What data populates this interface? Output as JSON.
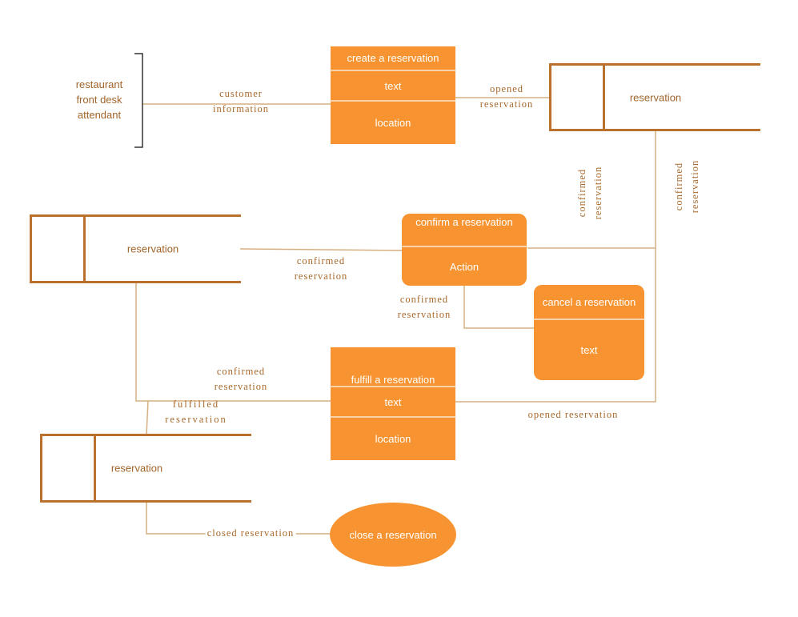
{
  "colors": {
    "process_fill": "#F79431",
    "store_stroke": "#BA712E",
    "flow_line": "#D6AF80",
    "label_text": "#A8692C"
  },
  "external_entity": {
    "lines": [
      "restaurant",
      "front desk",
      "attendant"
    ]
  },
  "processes": {
    "create": {
      "title": "create a reservation",
      "rows": [
        "text",
        "location"
      ]
    },
    "confirm": {
      "title": "confirm a reservation",
      "rows": [
        "Action"
      ]
    },
    "cancel": {
      "title": "cancel a reservation",
      "rows": [
        "text"
      ]
    },
    "fulfill": {
      "title": "fulfill a reservation",
      "rows": [
        "text",
        "location"
      ]
    },
    "close": {
      "title": "close a reservation"
    }
  },
  "stores": [
    {
      "name": "reservation"
    },
    {
      "name": "reservation"
    },
    {
      "name": "reservation"
    }
  ],
  "flows": {
    "customer_info": [
      "customer",
      "information"
    ],
    "opened_top": [
      "opened",
      "reservation"
    ],
    "confirmed_v1": [
      "confirmed",
      "reservation"
    ],
    "confirmed_v2": [
      "confirmed",
      "reservation"
    ],
    "confirmed_mid": [
      "confirmed",
      "reservation"
    ],
    "confirmed_cancel": [
      "confirmed",
      "reservation"
    ],
    "confirmed_fulfill": [
      "confirmed",
      "reservation"
    ],
    "fulfilled": [
      "fulfilled",
      "reservation"
    ],
    "opened_bottom": "opened reservation",
    "closed": "closed reservation"
  }
}
